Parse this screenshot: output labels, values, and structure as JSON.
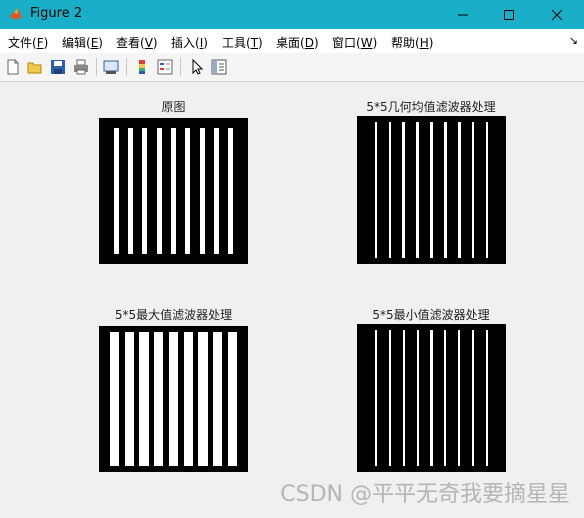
{
  "window": {
    "title": "Figure 2",
    "controls": [
      "minimize",
      "maximize",
      "close"
    ]
  },
  "menubar": {
    "items": [
      {
        "label": "文件(",
        "key": "F",
        "suffix": ")"
      },
      {
        "label": "编辑(",
        "key": "E",
        "suffix": ")"
      },
      {
        "label": "查看(",
        "key": "V",
        "suffix": ")"
      },
      {
        "label": "插入(",
        "key": "I",
        "suffix": ")"
      },
      {
        "label": "工具(",
        "key": "T",
        "suffix": ")"
      },
      {
        "label": "桌面(",
        "key": "D",
        "suffix": ")"
      },
      {
        "label": "窗口(",
        "key": "W",
        "suffix": ")"
      },
      {
        "label": "帮助(",
        "key": "H",
        "suffix": ")"
      }
    ],
    "overflow_glyph": "↘"
  },
  "toolbar": {
    "icons": [
      "new-figure-icon",
      "open-file-icon",
      "save-icon",
      "print-icon",
      "print-preview-icon",
      "colorbar-icon",
      "legend-icon",
      "pointer-icon",
      "property-editor-icon"
    ]
  },
  "subplots": [
    {
      "title": "原图",
      "stripes": 9,
      "stripe_fraction": 0.33
    },
    {
      "title": "5*5几何均值滤波器处理",
      "stripes": 9,
      "stripe_fraction": 0.18
    },
    {
      "title": "5*5最大值滤波器处理",
      "stripes": 9,
      "stripe_fraction": 0.62
    },
    {
      "title": "5*5最小值滤波器处理",
      "stripes": 9,
      "stripe_fraction": 0.15
    }
  ],
  "colors": {
    "titlebar": "#1aafc8",
    "figure_bg": "#f0f0f0",
    "image_bg": "#000000",
    "stripe": "#ffffff"
  },
  "watermark": "CSDN @平平无奇我要摘星星"
}
